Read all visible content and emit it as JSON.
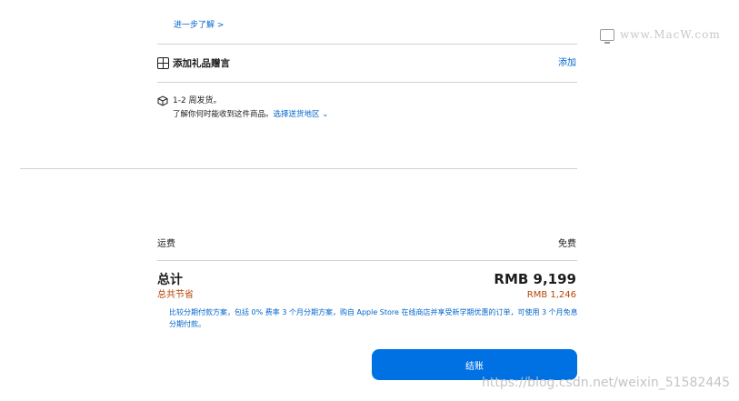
{
  "learn_more": "进一步了解 >",
  "gift": {
    "label": "添加礼品赠言",
    "action": "添加"
  },
  "delivery": {
    "time": "1-2 周发货。",
    "info_prefix": "了解你何时能收到这件商品。",
    "choose_area": "选择送货地区",
    "chevron": "⌄"
  },
  "summary": {
    "shipping_label": "运费",
    "shipping_value": "免费",
    "total_label": "总计",
    "total_value": "RMB 9,199",
    "saving_label": "总共节省",
    "saving_value": "RMB 1,246",
    "installment_note": "比较分期付款方案，包括 0% 费率 3 个月分期方案，购自 Apple Store 在线商店并享受新学期优惠的订单，可使用 3 个月免息分期付款。"
  },
  "checkout_label": "结账",
  "watermarks": {
    "mac": "www.MacW.com",
    "csdn": "https://blog.csdn.net/weixin_51582445"
  },
  "colors": {
    "link": "#0066cc",
    "button": "#0071e3",
    "saving": "#b64400"
  }
}
